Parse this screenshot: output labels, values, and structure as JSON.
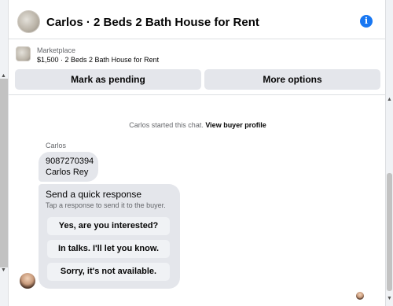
{
  "header": {
    "title": "Carlos · 2 Beds 2 Bath House for Rent",
    "avatar_icon": "house-photo",
    "info_icon": "info-icon",
    "accent_color": "#1877f2"
  },
  "listing": {
    "kicker": "Marketplace",
    "summary": "$1,500 · 2 Beds 2 Bath House for Rent",
    "buttons": {
      "pending": "Mark as pending",
      "more": "More options"
    }
  },
  "chat": {
    "system_prefix": "Carlos started this chat.",
    "system_link": "View buyer profile",
    "sender_name": "Carlos",
    "message_lines": [
      "9087270394",
      "Carlos Rey"
    ],
    "quick_response": {
      "title": "Send a quick response",
      "subtitle": "Tap a response to send it to the buyer.",
      "options": [
        "Yes, are you interested?",
        "In talks. I'll let you know.",
        "Sorry, it's not available."
      ]
    }
  }
}
